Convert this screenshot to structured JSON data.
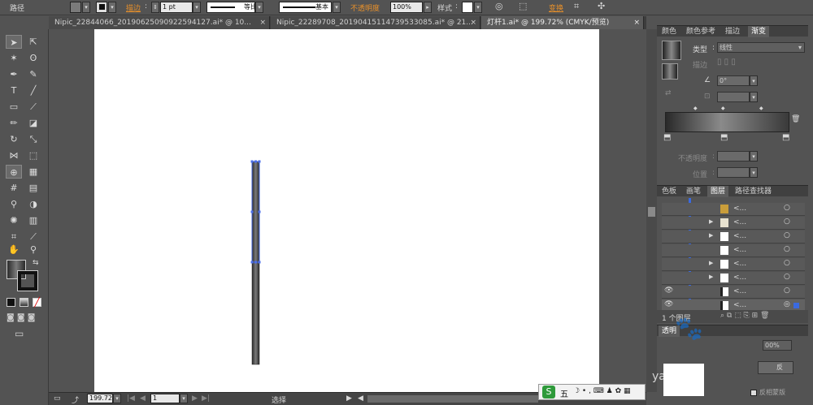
{
  "control_bar": {
    "path_label": "路径",
    "stroke_label": "描边",
    "stroke_value": "1 pt",
    "profile_equal": "等比",
    "brush_basic": "基本",
    "opacity_label": "不透明度",
    "opacity_value": "100%",
    "style_label": "样式",
    "transform_label": "变换",
    "accent_orange": "#e8902a"
  },
  "tabs": [
    {
      "label": "Nipic_22844066_20190625090922594127.ai* @ 10...",
      "close": "×"
    },
    {
      "label": "Nipic_22289708_20190415114739533085.ai* @ 21...",
      "close": "×"
    },
    {
      "label": "灯杆1.ai* @ 199.72% (CMYK/预览)",
      "close": "×"
    }
  ],
  "statusbar": {
    "zoom": "199.72",
    "page": "1",
    "tool": "选择"
  },
  "color_panel": {
    "tabs": [
      "颜色",
      "颜色参考",
      "描边",
      "渐变"
    ],
    "type_label": "类型",
    "type_value": "线性",
    "stroke_label": "描边",
    "angle_value": "0°",
    "opacity_label": "不透明度",
    "position_label": "位置"
  },
  "layers_panel": {
    "tabs": [
      "色板",
      "画笔",
      "图层",
      "路径查找器"
    ],
    "rows": [
      "<...",
      "<...",
      "<...",
      "<...",
      "<...",
      "<...",
      "<...",
      "<...",
      "<..."
    ],
    "footer": "1 个图层"
  },
  "transparency_panel": {
    "tab": "透明",
    "pct": "00%",
    "button_suffix": "反",
    "invert_mask": "反相蒙版"
  },
  "ime_bar": {
    "brand": "S",
    "mode": "五"
  },
  "watermark": "yan.b"
}
